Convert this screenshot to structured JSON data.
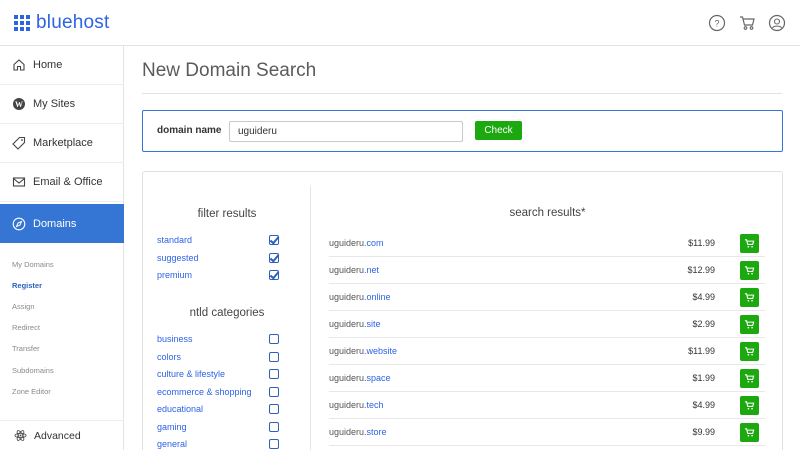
{
  "header": {
    "brand": "bluehost",
    "icons": [
      "help-icon",
      "cart-icon",
      "account-icon"
    ]
  },
  "sidebar": {
    "items": [
      {
        "label": "Home",
        "icon": "home-icon"
      },
      {
        "label": "My Sites",
        "icon": "wordpress-icon"
      },
      {
        "label": "Marketplace",
        "icon": "tag-icon"
      },
      {
        "label": "Email & Office",
        "icon": "envelope-icon"
      },
      {
        "label": "Domains",
        "icon": "compass-icon",
        "active": true
      }
    ],
    "subitems": [
      "My Domains",
      "Register",
      "Assign",
      "Redirect",
      "Transfer",
      "Subdomains",
      "Zone Editor"
    ],
    "active_subitem": "Register",
    "bottom_item": {
      "label": "Advanced",
      "icon": "atom-icon"
    }
  },
  "main": {
    "title": "New Domain Search",
    "search": {
      "label": "domain name",
      "value": "uguideru",
      "button": "Check"
    },
    "filters": {
      "heading": "filter results",
      "items": [
        {
          "label": "standard",
          "checked": true
        },
        {
          "label": "suggested",
          "checked": true
        },
        {
          "label": "premium",
          "checked": true
        }
      ]
    },
    "ntld": {
      "heading": "ntld categories",
      "items": [
        {
          "label": "business",
          "checked": false
        },
        {
          "label": "colors",
          "checked": false
        },
        {
          "label": "culture & lifestyle",
          "checked": false
        },
        {
          "label": "ecommerce & shopping",
          "checked": false
        },
        {
          "label": "educational",
          "checked": false
        },
        {
          "label": "gaming",
          "checked": false
        },
        {
          "label": "general",
          "checked": false
        }
      ]
    },
    "results": {
      "heading": "search results*",
      "rows": [
        {
          "name": "uguideru",
          "tld": ".com",
          "price": "$11.99"
        },
        {
          "name": "uguideru",
          "tld": ".net",
          "price": "$12.99"
        },
        {
          "name": "uguideru",
          "tld": ".online",
          "price": "$4.99"
        },
        {
          "name": "uguideru",
          "tld": ".site",
          "price": "$2.99"
        },
        {
          "name": "uguideru",
          "tld": ".website",
          "price": "$11.99"
        },
        {
          "name": "uguideru",
          "tld": ".space",
          "price": "$1.99"
        },
        {
          "name": "uguideru",
          "tld": ".tech",
          "price": "$4.99"
        },
        {
          "name": "uguideru",
          "tld": ".store",
          "price": "$9.99"
        }
      ]
    }
  },
  "colors": {
    "brand_blue": "#2d63e5",
    "active_nav": "#3575d3",
    "button_green": "#1ca80f"
  }
}
